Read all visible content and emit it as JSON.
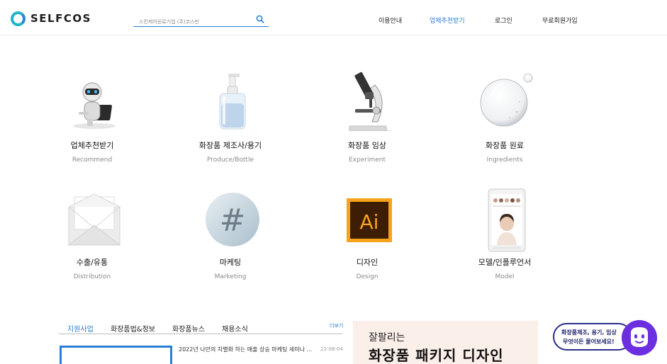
{
  "header": {
    "logo_text": "SELFCOS",
    "search_placeholder": "스킨케어원료기업 (주)코스만",
    "nav": [
      "이용안내",
      "업체추천받기",
      "로그인",
      "무료회원가입"
    ]
  },
  "categories": [
    {
      "title": "업체추천받기",
      "subtitle": "Recommend",
      "icon": "robot-icon"
    },
    {
      "title": "화장품 제조사/용기",
      "subtitle": "Produce/Bottle",
      "icon": "pump-bottle-icon"
    },
    {
      "title": "화장품 임상",
      "subtitle": "Experiment",
      "icon": "microscope-icon"
    },
    {
      "title": "화장품 원료",
      "subtitle": "Ingredients",
      "icon": "bubble-icon"
    },
    {
      "title": "수출/유통",
      "subtitle": "Distribution",
      "icon": "envelope-icon"
    },
    {
      "title": "마케팅",
      "subtitle": "Marketing",
      "icon": "hashtag-icon"
    },
    {
      "title": "디자인",
      "subtitle": "Design",
      "icon": "illustrator-icon"
    },
    {
      "title": "모델/인플루언서",
      "subtitle": "Model",
      "icon": "smartphone-icon"
    }
  ],
  "board": {
    "tabs": [
      "지원사업",
      "화장품법&정보",
      "화장품뉴스",
      "채용소식"
    ],
    "more_label": "더보기",
    "news": [
      {
        "title": "2022년 나만의 차별화 하는 매출 상승 마케팅 세미나 ...",
        "date": "22-08-04"
      }
    ]
  },
  "banner": {
    "subtitle": "잘팔리는",
    "title": "화장품 패키지 디자인"
  },
  "chat": {
    "line1": "화장품제조, 용기, 임상",
    "line2": "무엇이든 물어보세요!"
  },
  "colors": {
    "accent": "#2a7fd4",
    "chat_purple": "#6b2fe0",
    "illustrator_orange": "#f7a21b"
  }
}
